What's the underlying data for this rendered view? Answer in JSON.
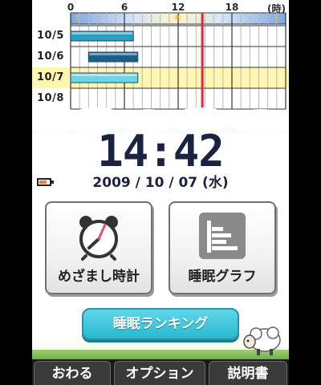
{
  "chart": {
    "hour_ticks": [
      "0",
      "6",
      "12",
      "18"
    ],
    "hour_unit": "(時)",
    "moon_icon": "crescent-moon-icon",
    "sun_icon": "sun-icon",
    "days": [
      {
        "label": "10/5",
        "highlighted": false,
        "sleep_start_hour": 0,
        "sleep_end_hour": 7,
        "bar_color": "#2a9ec0"
      },
      {
        "label": "10/6",
        "highlighted": false,
        "sleep_start_hour": 2,
        "sleep_end_hour": 7.5,
        "bar_color": "#1a5f88"
      },
      {
        "label": "10/7",
        "highlighted": true,
        "sleep_start_hour": 0,
        "sleep_end_hour": 7.5,
        "bar_color": "#6ad6e6"
      },
      {
        "label": "10/8",
        "highlighted": false,
        "sleep_start_hour": null,
        "sleep_end_hour": null,
        "bar_color": null
      }
    ],
    "current_hour": 14.7,
    "highlight_color": "#fff6b0",
    "current_line_color": "#e0283a"
  },
  "clock": {
    "time": "14:42",
    "date": "2009 / 10 / 07 (水)"
  },
  "battery": {
    "icon": "battery-icon",
    "level_fraction": 0.75,
    "fill_color": "#f08030"
  },
  "buttons": {
    "alarm_label": "めざまし時計",
    "alarm_icon": "alarm-clock-icon",
    "graph_label": "睡眠グラフ",
    "graph_icon": "bar-graph-icon",
    "ranking_label": "睡眠ランキング"
  },
  "tabs": {
    "quit": "おわる",
    "options": "オプション",
    "manual": "説明書"
  },
  "decor": {
    "sheep_icon": "sheep-icon"
  }
}
